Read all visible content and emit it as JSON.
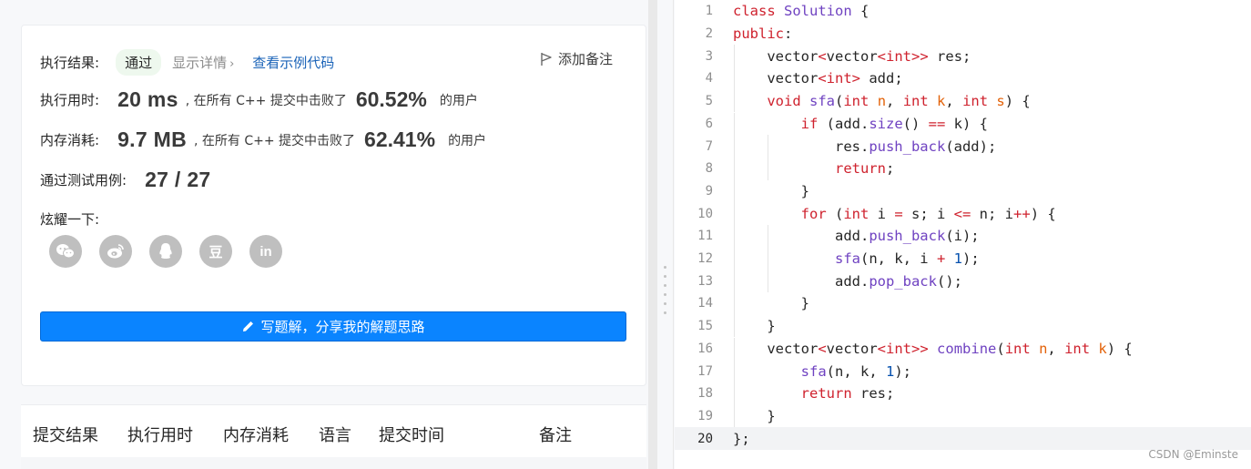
{
  "result": {
    "status_label": "执行结果:",
    "status_value": "通过",
    "details_label": "显示详情",
    "example_link": "查看示例代码",
    "note_button": "添加备注",
    "runtime_label": "执行用时:",
    "runtime_value": "20 ms",
    "runtime_mid": ", 在所有 C++ 提交中击败了",
    "runtime_pct": "60.52%",
    "runtime_tail": "的用户",
    "memory_label": "内存消耗:",
    "memory_value": "9.7 MB",
    "memory_mid": ", 在所有 C++ 提交中击败了",
    "memory_pct": "62.41%",
    "memory_tail": "的用户",
    "tests_label": "通过测试用例:",
    "tests_value": "27 / 27",
    "share_label": "炫耀一下:",
    "share_icons": [
      "wechat-icon",
      "weibo-icon",
      "qq-icon",
      "douban-icon",
      "linkedin-icon"
    ],
    "share_glyphs": [
      "",
      "",
      "",
      "豆",
      "in"
    ],
    "write_button": "写题解，分享我的解题思路"
  },
  "submissions": {
    "columns": [
      "提交结果",
      "执行用时",
      "内存消耗",
      "语言",
      "提交时间",
      "备注"
    ]
  },
  "editor": {
    "line_numbers": [
      "1",
      "2",
      "3",
      "4",
      "5",
      "6",
      "7",
      "8",
      "9",
      "10",
      "11",
      "12",
      "13",
      "14",
      "15",
      "16",
      "17",
      "18",
      "19",
      "20"
    ],
    "active_line": 20,
    "lines": [
      "class Solution {",
      "public:",
      "    vector<vector<int>> res;",
      "    vector<int> add;",
      "    void sfa(int n, int k, int s) {",
      "        if (add.size() == k) {",
      "            res.push_back(add);",
      "            return;",
      "        }",
      "        for (int i = s; i <= n; i++) {",
      "            add.push_back(i);",
      "            sfa(n, k, i + 1);",
      "            add.pop_back();",
      "        }",
      "    }",
      "    vector<vector<int>> combine(int n, int k) {",
      "        sfa(n, k, 1);",
      "        return res;",
      "    }",
      "};"
    ],
    "watermark": "CSDN @Eminste"
  },
  "colors": {
    "accent_blue": "#0a84ff",
    "link_blue": "#1a63b8",
    "keyword_red": "#cf222e",
    "function_purple": "#6f42c1",
    "number_blue": "#0550ae",
    "param_orange": "#e36209"
  }
}
